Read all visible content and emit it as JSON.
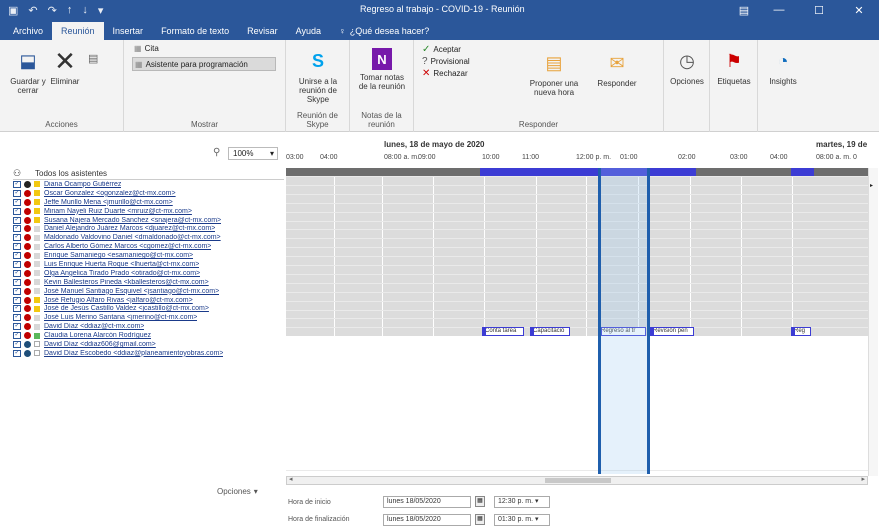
{
  "window": {
    "title": "Regreso al trabajo - COVID-19 - Reunión"
  },
  "tabs": [
    "Archivo",
    "Reunión",
    "Insertar",
    "Formato de texto",
    "Revisar",
    "Ayuda"
  ],
  "active_tab": "Reunión",
  "tell_me": "¿Qué desea hacer?",
  "ribbon": {
    "acciones": {
      "label": "Acciones",
      "save_close": "Guardar y cerrar",
      "delete": "Eliminar"
    },
    "mostrar": {
      "label": "Mostrar",
      "cita": "Cita",
      "asistente": "Asistente para programación"
    },
    "skype": {
      "label": "Reunión de Skype",
      "join": "Unirse a la reunión de Skype"
    },
    "onenote": {
      "label": "Notas de la reunión",
      "take_notes": "Tomar notas de la reunión"
    },
    "responder": {
      "label": "Responder",
      "accept": "Aceptar",
      "tentative": "Provisional",
      "decline": "Rechazar",
      "propose": "Proponer una nueva hora",
      "respond": "Responder"
    },
    "options": "Opciones",
    "tags": "Etiquetas",
    "insights": "Insights"
  },
  "zoom": "100%",
  "attendees": {
    "header": "Todos los asistentes",
    "rows": [
      {
        "name": "Diana Ocampo Gutiérrez",
        "type": "org",
        "status": "#f2c811"
      },
      {
        "name": "Oscar Gonzalez <ogonzalez@ct-mx.com>",
        "type": "req",
        "status": "#f2c811"
      },
      {
        "name": "Jeffe Murillo Mena <jmurillo@ct-mx.com>",
        "type": "req",
        "status": "#f2c811"
      },
      {
        "name": "Miriam Nayeli Ruiz Duarte <mruiz@ct-mx.com>",
        "type": "req",
        "status": "#f2c811"
      },
      {
        "name": "Susana Najera Mercado Sanchez <snajera@ct-mx.com>",
        "type": "req",
        "status": "#f2c811"
      },
      {
        "name": "Daniel Alejandro Juárez Marcos <djuarez@ct-mx.com>",
        "type": "req",
        "status": "#d8d8d8"
      },
      {
        "name": "Maldonado Valdovino Daniel <dmaldonado@ct-mx.com>",
        "type": "req",
        "status": "#d8d8d8"
      },
      {
        "name": "Carlos Alberto Gómez Marcos <cgomez@ct-mx.com>",
        "type": "req",
        "status": "#d8d8d8"
      },
      {
        "name": "Enrique Samaniego <esamaniego@ct-mx.com>",
        "type": "req",
        "status": "#d8d8d8"
      },
      {
        "name": "Luis Enrique Huerta Roque <lhuerta@ct-mx.com>",
        "type": "req",
        "status": "#d8d8d8"
      },
      {
        "name": "Olga Angelica Tirado Prado <otirado@ct-mx.com>",
        "type": "req",
        "status": "#d8d8d8"
      },
      {
        "name": "Kevin Ballesteros Pineda <kballesteros@ct-mx.com>",
        "type": "req",
        "status": "#d8d8d8"
      },
      {
        "name": "José Manuel Santiago Esquivel <jsantiago@ct-mx.com>",
        "type": "req",
        "status": "#d8d8d8"
      },
      {
        "name": "José Refugio Alfaro Rivas <jalfaro@ct-mx.com>",
        "type": "req",
        "status": "#f2c811"
      },
      {
        "name": "José de Jesús Castillo Valdez <jcastillo@ct-mx.com>",
        "type": "req",
        "status": "#f2c811"
      },
      {
        "name": "José Luis Merino Santana <jmerino@ct-mx.com>",
        "type": "req",
        "status": "#d8d8d8"
      },
      {
        "name": "David Díaz <ddiaz@ct-mx.com>",
        "type": "req",
        "status": "#d8d8d8"
      },
      {
        "name": "Claudia Lorena Alarcón Rodríguez",
        "type": "req",
        "status": "#5bb85b"
      },
      {
        "name": "David Díaz <ddiaz606@gmail.com>",
        "type": "opt",
        "status": "#ffffff"
      },
      {
        "name": "David Díaz Escobedo <ddiaz@planeamientoyobras.com>",
        "type": "opt",
        "status": "#ffffff"
      }
    ]
  },
  "timeline": {
    "date1": "lunes, 18 de mayo de 2020",
    "date2": "martes, 19 de",
    "hours_left": [
      "03:00",
      "04:00"
    ],
    "hours_main": [
      "08:00 a. m.",
      "09:00",
      "10:00",
      "11:00",
      "12:00 p. m.",
      "01:00",
      "02:00",
      "03:00",
      "04:00"
    ],
    "hour_right": "08:00 a. m. 0",
    "tentative_labels": [
      "Conta tarea",
      "Capacitació",
      "Regreso al tr",
      "Revisión pen",
      "Reg"
    ]
  },
  "bottom": {
    "options_btn": "Opciones",
    "start_label": "Hora de inicio",
    "end_label": "Hora de finalización",
    "start_date": "lunes 18/05/2020",
    "start_time": "12:30 p. m.",
    "end_date": "lunes 18/05/2020",
    "end_time": "01:30 p. m."
  },
  "colors": {
    "brand": "#2b579a",
    "busy": "#3c3cd4",
    "selection": "#1f5fad"
  }
}
